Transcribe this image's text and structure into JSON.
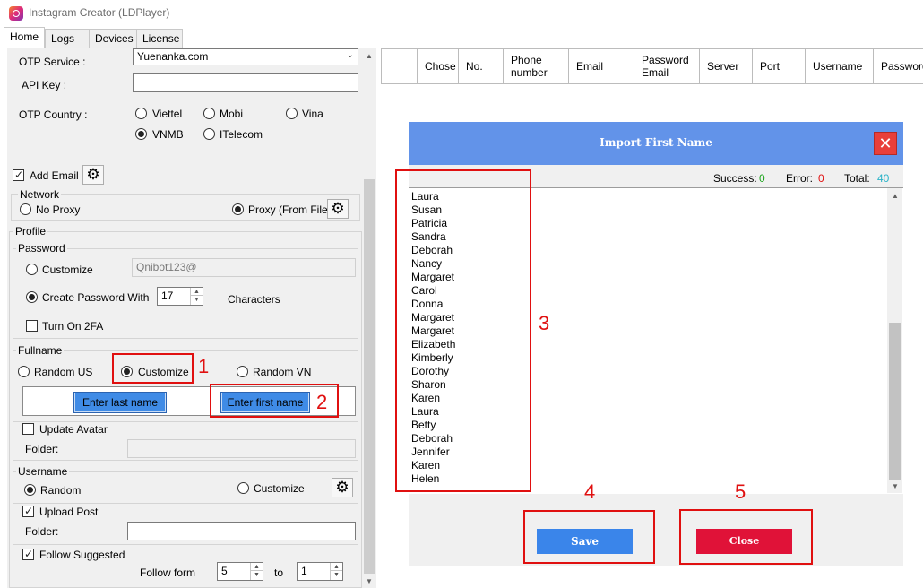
{
  "window": {
    "title": "Instagram Creator (LDPlayer)",
    "icon": "instagram-icon"
  },
  "tabs": [
    {
      "label": "Home",
      "active": true
    },
    {
      "label": "Logs"
    },
    {
      "label": "Devices"
    },
    {
      "label": "License"
    }
  ],
  "otp": {
    "service_label": "OTP Service :",
    "service_value": "Yuenanka.com",
    "api_key_label": "API Key :",
    "api_key_value": "",
    "country_label": "OTP Country :",
    "countries": [
      {
        "label": "Viettel",
        "selected": false
      },
      {
        "label": "Mobi",
        "selected": false
      },
      {
        "label": "Vina",
        "selected": false
      },
      {
        "label": "VNMB",
        "selected": true
      },
      {
        "label": "ITelecom",
        "selected": false
      }
    ]
  },
  "add_email": {
    "label": "Add Email",
    "checked": true
  },
  "network": {
    "title": "Network",
    "no_proxy": "No Proxy",
    "proxy_file": "Proxy (From File)",
    "selected": "Proxy (From File)"
  },
  "profile": {
    "title": "Profile",
    "password": {
      "title": "Password",
      "customize_label": "Customize",
      "customize_value": "Qnibot123@",
      "create_label": "Create Password With",
      "length": "17",
      "characters_label": "Characters",
      "twofa_label": "Turn On 2FA"
    },
    "fullname": {
      "title": "Fullname",
      "random_us": "Random US",
      "customize": "Customize",
      "random_vn": "Random VN",
      "enter_last": "Enter last name",
      "enter_first": "Enter first name"
    },
    "update_avatar": "Update Avatar",
    "folder_label": "Folder:",
    "username": {
      "title": "Username",
      "random": "Random",
      "customize": "Customize"
    },
    "upload_post": "Upload Post",
    "upload_folder_label": "Folder:",
    "follow_suggested": "Follow Suggested",
    "follow_form_label": "Follow form",
    "follow_from": "5",
    "to_label": "to",
    "follow_to": "1"
  },
  "grid": {
    "columns": [
      "Chose",
      "No.",
      "Phone number",
      "Email",
      "Password Email",
      "Server",
      "Port",
      "Username",
      "Password"
    ]
  },
  "dialog": {
    "title": "Import First Name",
    "success_label": "Success:",
    "success_value": "0",
    "error_label": "Error:",
    "error_value": "0",
    "total_label": "Total:",
    "total_value": "40",
    "names": [
      "Laura",
      "Susan",
      "Patricia",
      "Sandra",
      "Deborah",
      "Nancy",
      "Margaret",
      "Carol",
      "Donna",
      "Margaret",
      "Margaret",
      "Elizabeth",
      "Kimberly",
      "Dorothy",
      "Sharon",
      "Karen",
      "Laura",
      "Betty",
      "Deborah",
      "Jennifer",
      "Karen",
      "Helen"
    ],
    "save_label": "Save",
    "close_label": "Close",
    "colors": {
      "header": "#6293e9",
      "save": "#3a85ea",
      "close": "#e01238",
      "success": "#19a319",
      "error": "#e01010",
      "total": "#2ab3c8"
    }
  },
  "annotations": [
    "1",
    "2",
    "3",
    "4",
    "5"
  ]
}
